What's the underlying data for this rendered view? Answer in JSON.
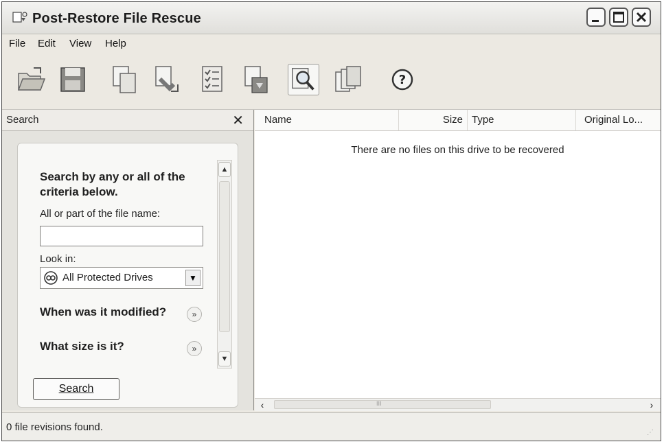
{
  "window": {
    "title": "Post-Restore File Rescue",
    "controls": [
      "minimize",
      "maximize",
      "close"
    ]
  },
  "menu": {
    "items": [
      "File",
      "Edit",
      "View",
      "Help"
    ]
  },
  "toolbar": {
    "icons": [
      "open-folder-icon",
      "save-icon",
      "copy-icon",
      "restore-icon",
      "checklist-icon",
      "recover-icon",
      "search-tool-icon",
      "versions-icon",
      "help-icon"
    ],
    "pressed": "search-tool-icon"
  },
  "search_pane": {
    "title": "Search",
    "close_glyph": "✕",
    "heading": "Search by any or all of the criteria below.",
    "filename_label": "All or part of the file name:",
    "filename_value": "",
    "look_in_label": "Look in:",
    "look_in_value": "All Protected Drives",
    "when_modified": "When was it modified?",
    "what_size": "What size is it?",
    "search_button": "Search"
  },
  "file_list": {
    "columns": [
      "Name",
      "Size",
      "Type",
      "Original Lo..."
    ],
    "empty_message": "There are no files on this drive to be recovered",
    "scroll_marker": "III"
  },
  "status": {
    "text": "0 file revisions found."
  },
  "colors": {
    "chrome": "#ece9e2",
    "list_bg": "#ffffff",
    "text": "#222222"
  }
}
